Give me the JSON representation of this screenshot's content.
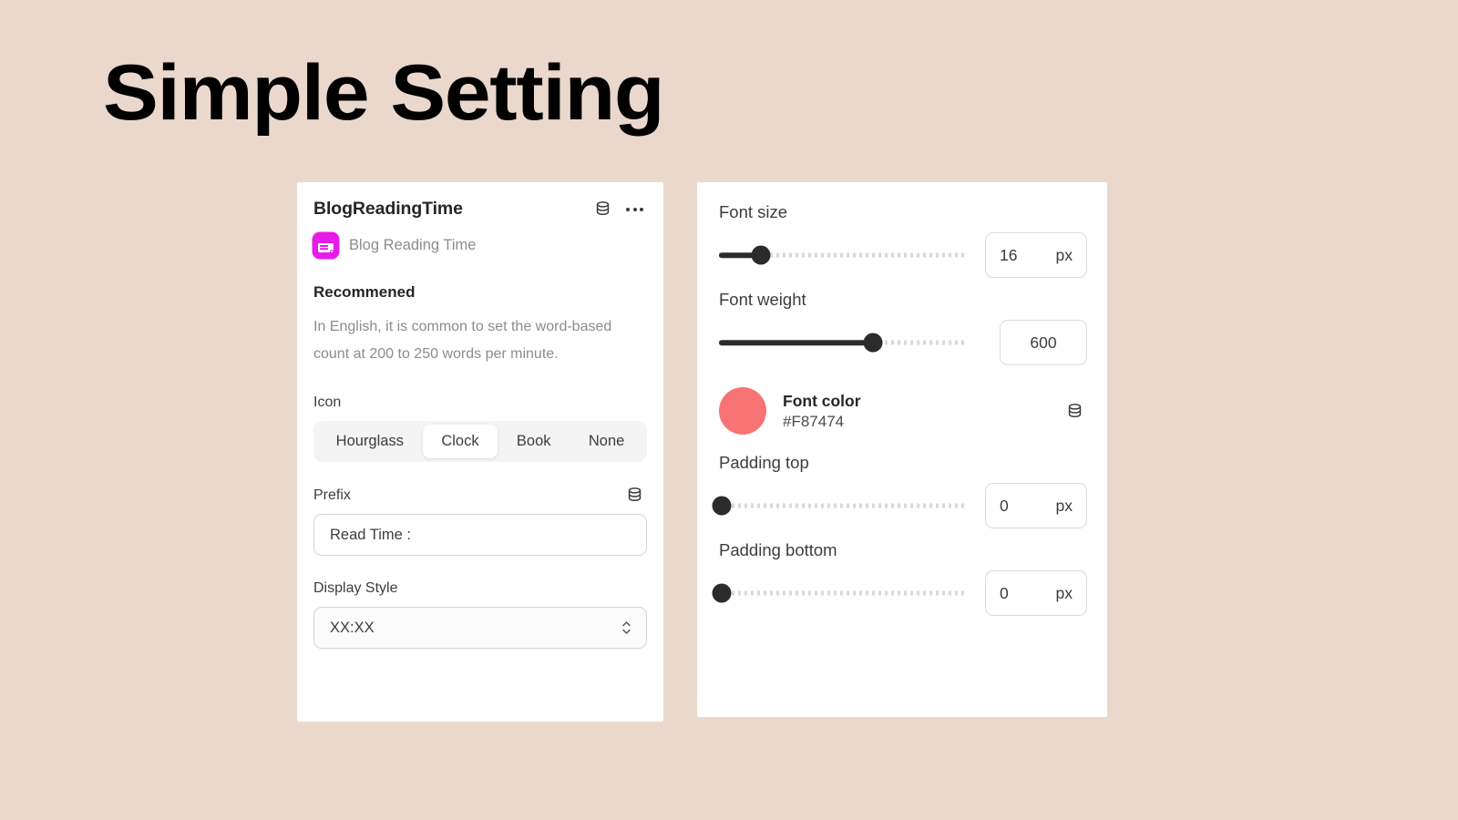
{
  "page": {
    "title": "Simple Setting",
    "background_color": "#EBD8CD"
  },
  "left_panel": {
    "card_title": "BlogReadingTime",
    "header_icons": {
      "database": "database-icon",
      "more": "more-options-icon"
    },
    "app_icon_name": "blog-reading-time-app-icon",
    "app_icon_color": "#E61CE6",
    "subtitle": "Blog Reading Time",
    "recommended": {
      "heading": "Recommened",
      "body": "In English, it is common to set the word-based count at 200 to 250 words per minute."
    },
    "icon_field": {
      "label": "Icon",
      "options": [
        "Hourglass",
        "Clock",
        "Book",
        "None"
      ],
      "selected": "Clock"
    },
    "prefix_field": {
      "label": "Prefix",
      "value": "Read Time :",
      "has_database_icon": true
    },
    "display_style_field": {
      "label": "Display Style",
      "value": "XX:XX"
    }
  },
  "right_panel": {
    "font_size": {
      "label": "Font size",
      "value": "16",
      "unit": "px",
      "slider_percent": 17
    },
    "font_weight": {
      "label": "Font weight",
      "value": "600",
      "unit": "",
      "slider_percent": 62
    },
    "font_color": {
      "label": "Font color",
      "hex": "#F87474",
      "swatch_color": "#F87474",
      "has_database_icon": true
    },
    "padding_top": {
      "label": "Padding top",
      "value": "0",
      "unit": "px",
      "slider_percent": 0
    },
    "padding_bottom": {
      "label": "Padding bottom",
      "value": "0",
      "unit": "px",
      "slider_percent": 0
    }
  }
}
